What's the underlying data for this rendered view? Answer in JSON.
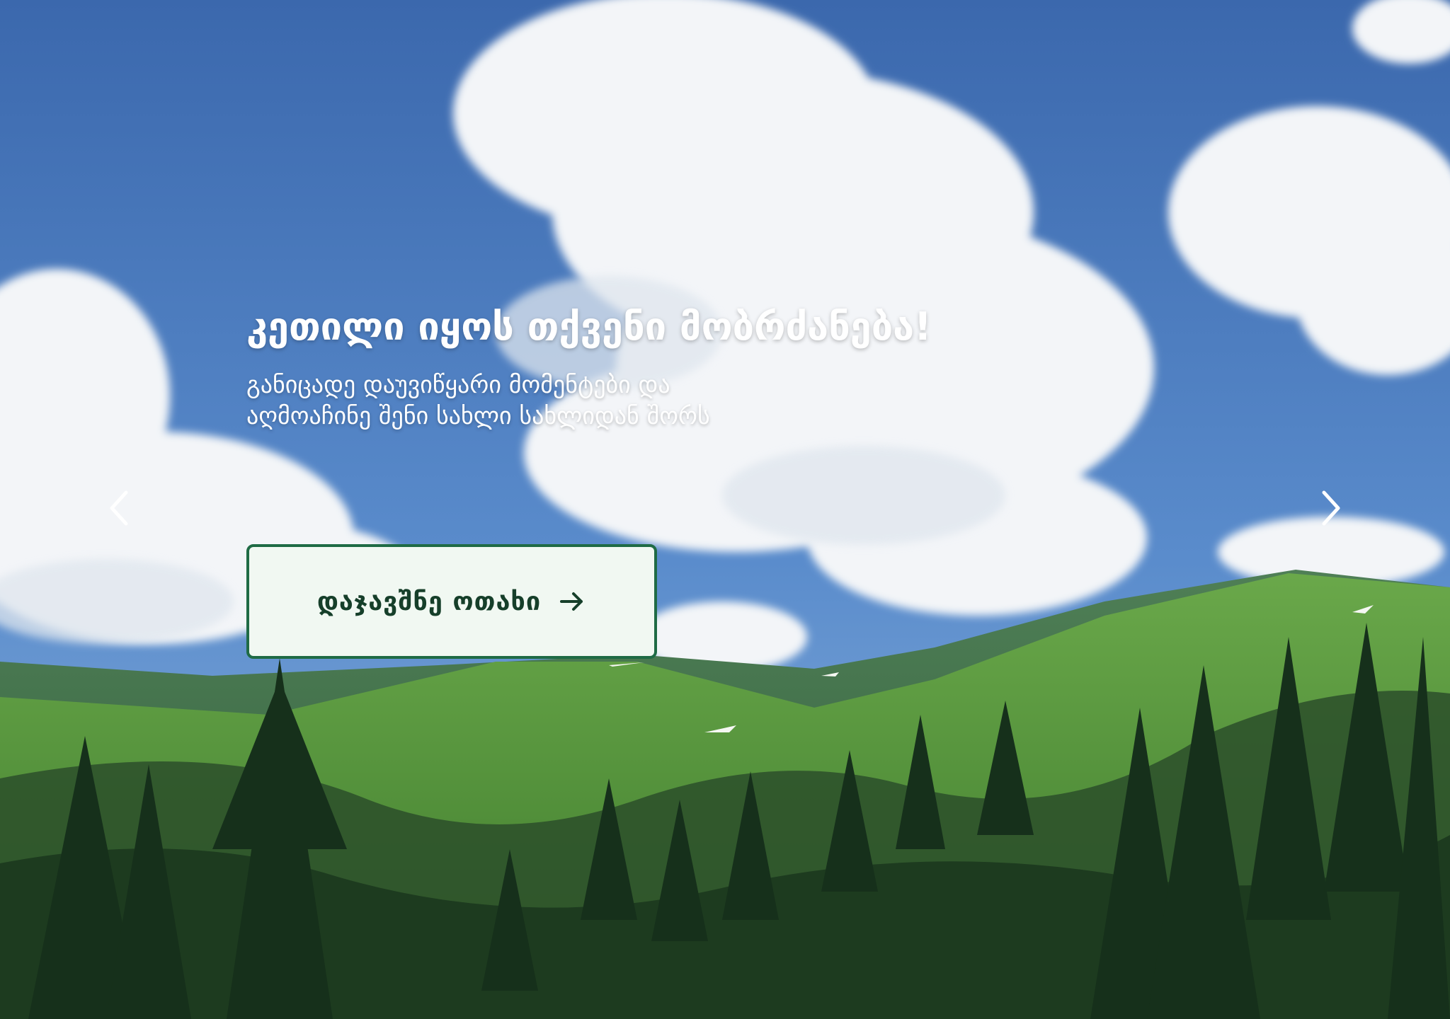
{
  "hero": {
    "title": "კეთილი იყოს თქვენი მობრძანება!",
    "subtitle_line1": "განიცადე დაუვიწყარი მომენტები და",
    "subtitle_line2": "აღმოაჩინე შენი სახლი სახლიდან შორს",
    "cta_label": "დაჯავშნე ოთახი",
    "cta_icon": "arrow-right-icon",
    "prev_icon": "chevron-left-icon",
    "next_icon": "chevron-right-icon",
    "background": "mountain-landscape-photo"
  },
  "colors": {
    "sky_top": "#3f6fb4",
    "cloud": "#f2f4f7",
    "grass": "#5f9f3a",
    "forest": "#1d3b22",
    "cta_bg": "#f1f8f2",
    "cta_border": "#1f6b45",
    "cta_text": "#163f2a",
    "text": "#ffffff"
  }
}
